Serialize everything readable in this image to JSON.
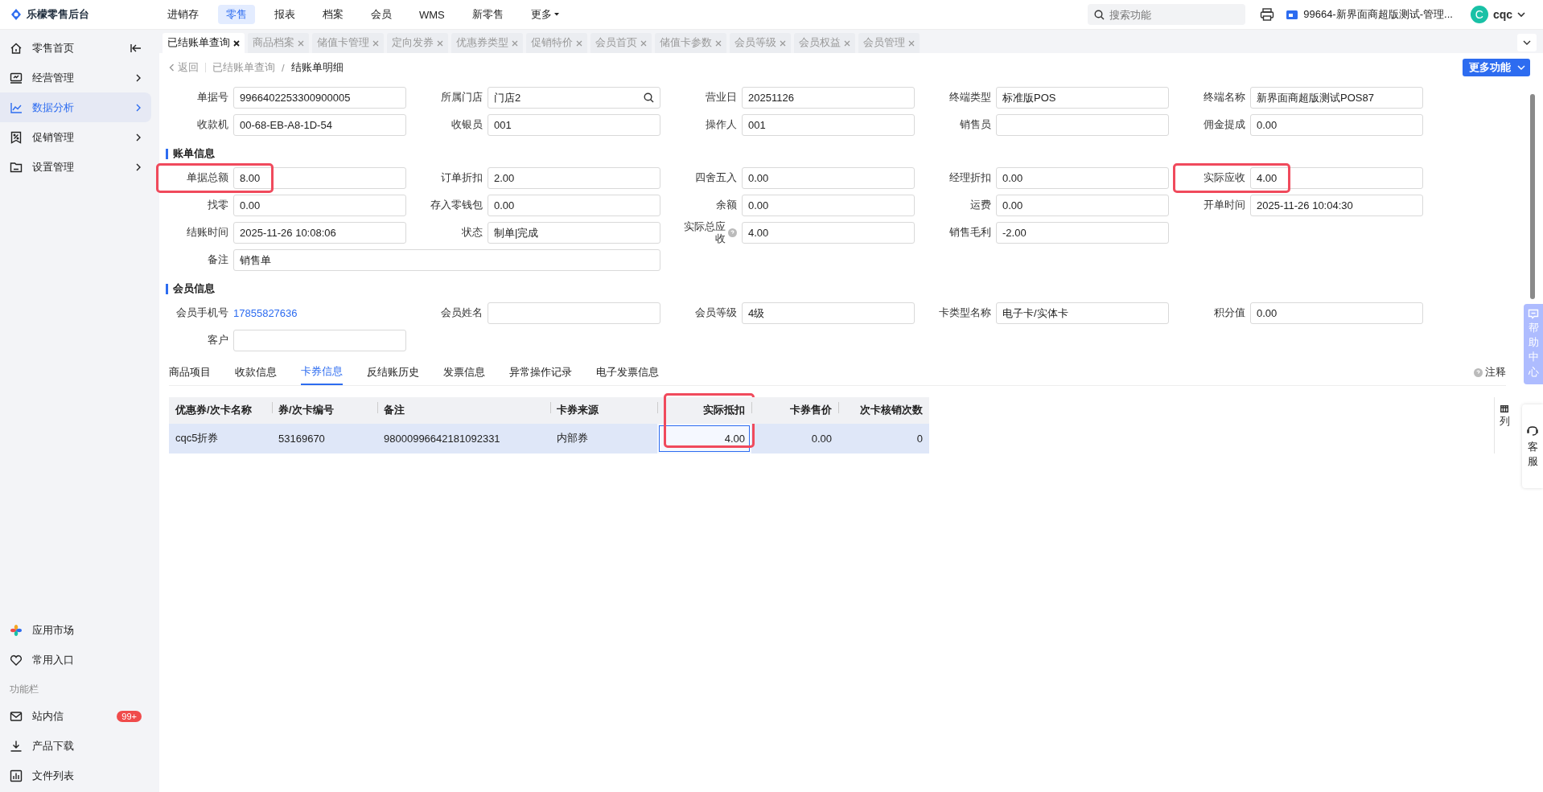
{
  "app": {
    "logo_text": "乐檬零售后台"
  },
  "top_nav": [
    {
      "label": "进销存",
      "selected": false,
      "kind": "link"
    },
    {
      "label": "零售",
      "selected": true,
      "kind": "link"
    },
    {
      "label": "报表",
      "selected": false,
      "kind": "link"
    },
    {
      "label": "档案",
      "selected": false,
      "kind": "link"
    },
    {
      "label": "会员",
      "selected": false,
      "kind": "link"
    },
    {
      "label": "WMS",
      "selected": false,
      "kind": "link"
    },
    {
      "label": "新零售",
      "selected": false,
      "kind": "link"
    },
    {
      "label": "更多",
      "selected": false,
      "kind": "dropdown"
    }
  ],
  "search": {
    "placeholder": "搜索功能"
  },
  "store": {
    "label": "99664-新界面商超版测试-管理..."
  },
  "user": {
    "avatar": "C",
    "name": "cqc"
  },
  "sidebar": {
    "items": [
      {
        "label": "零售首页",
        "selected": false,
        "kind": "home"
      },
      {
        "label": "经营管理",
        "selected": false,
        "kind": "group"
      },
      {
        "label": "数据分析",
        "selected": true,
        "kind": "group"
      },
      {
        "label": "促销管理",
        "selected": false,
        "kind": "group"
      },
      {
        "label": "设置管理",
        "selected": false,
        "kind": "group"
      }
    ],
    "bottom_items": [
      {
        "label": "应用市场"
      },
      {
        "label": "常用入口"
      }
    ],
    "section_label": "功能栏",
    "tool_items": [
      {
        "label": "站内信",
        "badge": "99+"
      },
      {
        "label": "产品下载"
      },
      {
        "label": "文件列表"
      }
    ]
  },
  "tabs": [
    {
      "label": "已结账单查询",
      "selected": true
    },
    {
      "label": "商品档案",
      "selected": false
    },
    {
      "label": "储值卡管理",
      "selected": false
    },
    {
      "label": "定向发券",
      "selected": false
    },
    {
      "label": "优惠券类型",
      "selected": false
    },
    {
      "label": "促销特价",
      "selected": false
    },
    {
      "label": "会员首页",
      "selected": false
    },
    {
      "label": "储值卡参数",
      "selected": false
    },
    {
      "label": "会员等级",
      "selected": false
    },
    {
      "label": "会员权益",
      "selected": false
    },
    {
      "label": "会员管理",
      "selected": false
    }
  ],
  "breadcrumb": {
    "back": "返回",
    "items": [
      "已结账单查询",
      "结账单明细"
    ],
    "separator": "/"
  },
  "more_button": {
    "label": "更多功能"
  },
  "header_fields": [
    {
      "label": "单据号",
      "value": "9966402253300900005",
      "kind": "text",
      "highlighted": false
    },
    {
      "label": "所属门店",
      "value": "门店2",
      "kind": "search",
      "highlighted": false
    },
    {
      "label": "营业日",
      "value": "20251126",
      "kind": "text",
      "highlighted": false
    },
    {
      "label": "终端类型",
      "value": "标准版POS",
      "kind": "text",
      "highlighted": false
    },
    {
      "label": "终端名称",
      "value": "新界面商超版测试POS87",
      "kind": "text",
      "highlighted": false
    },
    {
      "label": "收款机",
      "value": "00-68-EB-A8-1D-54",
      "kind": "text",
      "highlighted": false
    },
    {
      "label": "收银员",
      "value": "001",
      "kind": "text",
      "highlighted": false
    },
    {
      "label": "操作人",
      "value": "001",
      "kind": "text",
      "highlighted": false
    },
    {
      "label": "销售员",
      "kind": "text",
      "highlighted": false
    },
    {
      "label": "佣金提成",
      "value": "0.00",
      "kind": "text",
      "highlighted": false
    }
  ],
  "sections": [
    {
      "title": "账单信息",
      "fields": [
        {
          "label": "单据总额",
          "value": "8.00",
          "kind": "text",
          "highlighted": true
        },
        {
          "label": "订单折扣",
          "value": "2.00",
          "kind": "text",
          "highlighted": false
        },
        {
          "label": "四舍五入",
          "value": "0.00",
          "kind": "text",
          "highlighted": false
        },
        {
          "label": "经理折扣",
          "value": "0.00",
          "kind": "text",
          "highlighted": false
        },
        {
          "label": "实际应收",
          "value": "4.00",
          "kind": "text",
          "highlighted": true
        },
        {
          "label": "找零",
          "value": "0.00",
          "kind": "text",
          "highlighted": false
        },
        {
          "label": "存入零钱包",
          "value": "0.00",
          "kind": "text",
          "highlighted": false
        },
        {
          "label": "余额",
          "value": "0.00",
          "kind": "text",
          "highlighted": false
        },
        {
          "label": "运费",
          "value": "0.00",
          "kind": "text",
          "highlighted": false
        },
        {
          "label": "开单时间",
          "value": "2025-11-26 10:04:30",
          "kind": "text",
          "highlighted": false
        },
        {
          "label": "结账时间",
          "value": "2025-11-26 10:08:06",
          "kind": "text",
          "highlighted": false
        },
        {
          "label": "状态",
          "value": "制单|完成",
          "kind": "text",
          "highlighted": false
        },
        {
          "label": "实际总应收",
          "value": "4.00",
          "kind": "help",
          "highlighted": false
        },
        {
          "label": "销售毛利",
          "value": "-2.00",
          "kind": "text",
          "highlighted": false
        },
        {
          "label": "备注",
          "value": "销售单",
          "kind": "wide",
          "highlighted": false
        }
      ]
    },
    {
      "title": "会员信息",
      "fields": [
        {
          "label": "会员手机号",
          "value": "17855827636",
          "kind": "link",
          "highlighted": false
        },
        {
          "label": "会员姓名",
          "kind": "text",
          "highlighted": false
        },
        {
          "label": "会员等级",
          "value": "4级",
          "kind": "text",
          "highlighted": false
        },
        {
          "label": "卡类型名称",
          "value": "电子卡/实体卡",
          "kind": "text",
          "highlighted": false
        },
        {
          "label": "积分值",
          "value": "0.00",
          "kind": "text",
          "highlighted": false
        },
        {
          "label": "客户",
          "kind": "text",
          "highlighted": false
        }
      ]
    }
  ],
  "detail_tabs": [
    {
      "label": "商品项目",
      "selected": false
    },
    {
      "label": "收款信息",
      "selected": false
    },
    {
      "label": "卡券信息",
      "selected": true
    },
    {
      "label": "反结账历史",
      "selected": false
    },
    {
      "label": "发票信息",
      "selected": false
    },
    {
      "label": "异常操作记录",
      "selected": false
    },
    {
      "label": "电子发票信息",
      "selected": false
    }
  ],
  "note": {
    "label": "注释"
  },
  "table": {
    "columns": [
      {
        "label": "优惠券/次卡名称",
        "kind": "text",
        "highlighted": false
      },
      {
        "label": "券/次卡编号",
        "kind": "text",
        "highlighted": false
      },
      {
        "label": "备注",
        "kind": "text",
        "highlighted": false
      },
      {
        "label": "卡券来源",
        "kind": "text",
        "highlighted": false
      },
      {
        "label": "实际抵扣",
        "kind": "number",
        "highlighted": true
      },
      {
        "label": "卡券售价",
        "kind": "number",
        "highlighted": false
      },
      {
        "label": "次卡核销次数",
        "kind": "number",
        "highlighted": false
      }
    ],
    "rows": [
      {
        "selected": true,
        "cells": [
          {
            "text": "cqc5折券",
            "focused": false
          },
          {
            "text": "53169670",
            "focused": false
          },
          {
            "text": "98000996642181092331",
            "focused": false
          },
          {
            "text": "内部券",
            "focused": false
          },
          {
            "text": "4.00",
            "focused": true
          },
          {
            "text": "0.00",
            "focused": false
          },
          {
            "text": "0",
            "focused": false
          }
        ]
      }
    ]
  },
  "column_settings": {
    "label": "列"
  },
  "help_center": {
    "label": "帮助中心"
  },
  "service": {
    "label": "客服"
  }
}
